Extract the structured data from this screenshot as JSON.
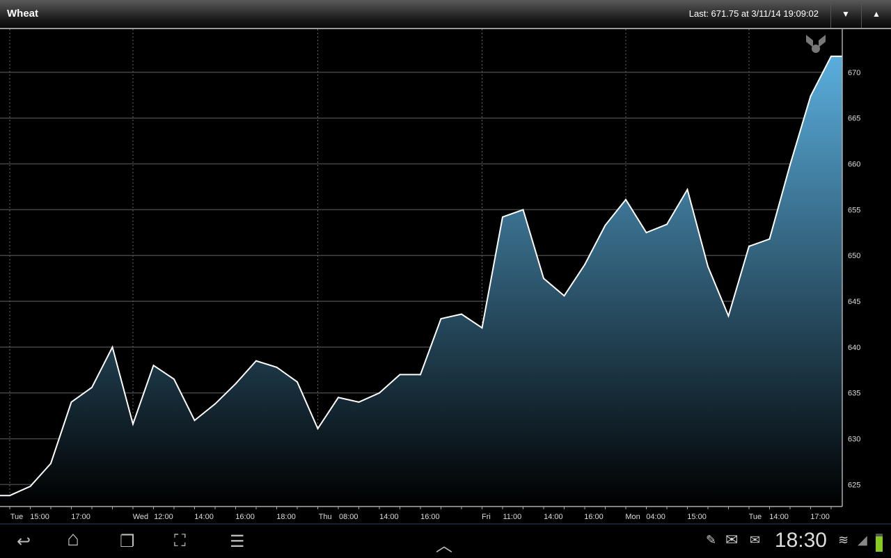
{
  "header": {
    "title": "Wheat",
    "last": "Last: 671.75 at 3/11/14 19:09:02",
    "down_icon": "▼",
    "up_icon": "▲"
  },
  "chart_data": {
    "type": "area",
    "title": "Wheat",
    "xlabel": "",
    "ylabel": "",
    "ylim": [
      622.6,
      674.7
    ],
    "yticks": [
      625,
      630,
      635,
      640,
      645,
      650,
      655,
      660,
      665,
      670
    ],
    "values": [
      623.8,
      624.8,
      627.3,
      634.0,
      635.6,
      640.0,
      631.6,
      638.0,
      636.5,
      632.0,
      633.8,
      636.0,
      638.5,
      637.8,
      636.2,
      631.1,
      634.5,
      634.0,
      635.0,
      637.0,
      637.0,
      643.1,
      643.6,
      642.1,
      654.2,
      655.0,
      647.5,
      645.6,
      649.0,
      653.3,
      656.1,
      652.5,
      653.4,
      657.2,
      648.8,
      643.4,
      651.0,
      651.8,
      659.9,
      667.4,
      671.75
    ],
    "day_boundaries": [
      0,
      6,
      15,
      23,
      30,
      36
    ],
    "xticks": [
      {
        "at": 0.34,
        "label": "Tue"
      },
      {
        "at": 1.46,
        "label": "15:00"
      },
      {
        "at": 3.46,
        "label": "17:00"
      },
      {
        "at": 6.37,
        "label": "Wed"
      },
      {
        "at": 7.49,
        "label": "12:00"
      },
      {
        "at": 9.46,
        "label": "14:00"
      },
      {
        "at": 11.46,
        "label": "16:00"
      },
      {
        "at": 13.46,
        "label": "18:00"
      },
      {
        "at": 15.36,
        "label": "Thu"
      },
      {
        "at": 16.5,
        "label": "08:00"
      },
      {
        "at": 18.47,
        "label": "14:00"
      },
      {
        "at": 20.47,
        "label": "16:00"
      },
      {
        "at": 23.2,
        "label": "Fri"
      },
      {
        "at": 24.47,
        "label": "11:00"
      },
      {
        "at": 26.47,
        "label": "14:00"
      },
      {
        "at": 28.44,
        "label": "16:00"
      },
      {
        "at": 30.34,
        "label": "Mon"
      },
      {
        "at": 31.46,
        "label": "04:00"
      },
      {
        "at": 33.46,
        "label": "15:00"
      },
      {
        "at": 36.3,
        "label": "Tue"
      },
      {
        "at": 37.46,
        "label": "14:00"
      },
      {
        "at": 39.46,
        "label": "17:00"
      }
    ],
    "colors": {
      "fill_top": "#5aaedd",
      "fill_bottom": "#000000",
      "line": "#ffffff",
      "grid": "#444444"
    }
  },
  "system_bar": {
    "clock": "18:30",
    "back_icon": "↩",
    "home_icon": "⌂",
    "recent_icon": "❐",
    "screenshot_icon": "⛶",
    "menu_icon": "☰",
    "up_icon": "︿",
    "pen_icon": "✎",
    "email_icon": "✉",
    "mail_icon": "✉",
    "wifi_icon": "≋",
    "signal_icon": "◢"
  }
}
